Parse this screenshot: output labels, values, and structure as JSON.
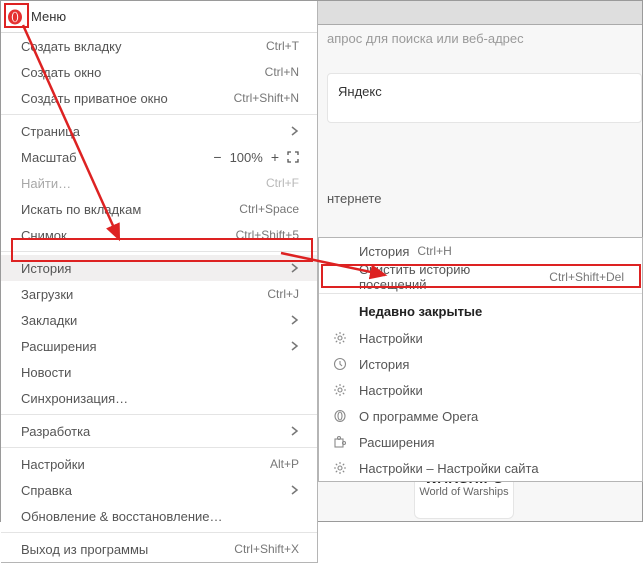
{
  "menu_title": "Меню",
  "main_menu": {
    "new_tab": "Создать вкладку",
    "new_tab_sc": "Ctrl+T",
    "new_window": "Создать окно",
    "new_window_sc": "Ctrl+N",
    "new_private": "Создать приватное окно",
    "new_private_sc": "Ctrl+Shift+N",
    "page": "Страница",
    "zoom": "Масштаб",
    "zoom_value": "100%",
    "find": "Найти…",
    "find_sc": "Ctrl+F",
    "search_tabs": "Искать по вкладкам",
    "search_tabs_sc": "Ctrl+Space",
    "snapshot": "Снимок",
    "snapshot_sc": "Ctrl+Shift+5",
    "history": "История",
    "downloads": "Загрузки",
    "downloads_sc": "Ctrl+J",
    "bookmarks": "Закладки",
    "extensions": "Расширения",
    "news": "Новости",
    "sync": "Синхронизация…",
    "developer": "Разработка",
    "settings": "Настройки",
    "settings_sc": "Alt+P",
    "help": "Справка",
    "update": "Обновление & восстановление…",
    "exit": "Выход из программы",
    "exit_sc": "Ctrl+Shift+X"
  },
  "submenu": {
    "history": "История",
    "history_sc": "Ctrl+H",
    "clear": "Очистить историю посещений",
    "clear_sc": "Ctrl+Shift+Del",
    "recent_heading": "Недавно закрытые",
    "r1": "Настройки",
    "r2": "История",
    "r3": "Настройки",
    "r4": "О программе Opera",
    "r5": "Расширения",
    "r6": "Настройки – Настройки сайта"
  },
  "page": {
    "search_placeholder": "апрос для поиска или веб-адрес",
    "yandex": "Яндекс",
    "internet": "нтернете",
    "warships_label": "World of Warships",
    "warships_logo": "WARSHIPS"
  },
  "colors": {
    "highlight": "#d22"
  }
}
